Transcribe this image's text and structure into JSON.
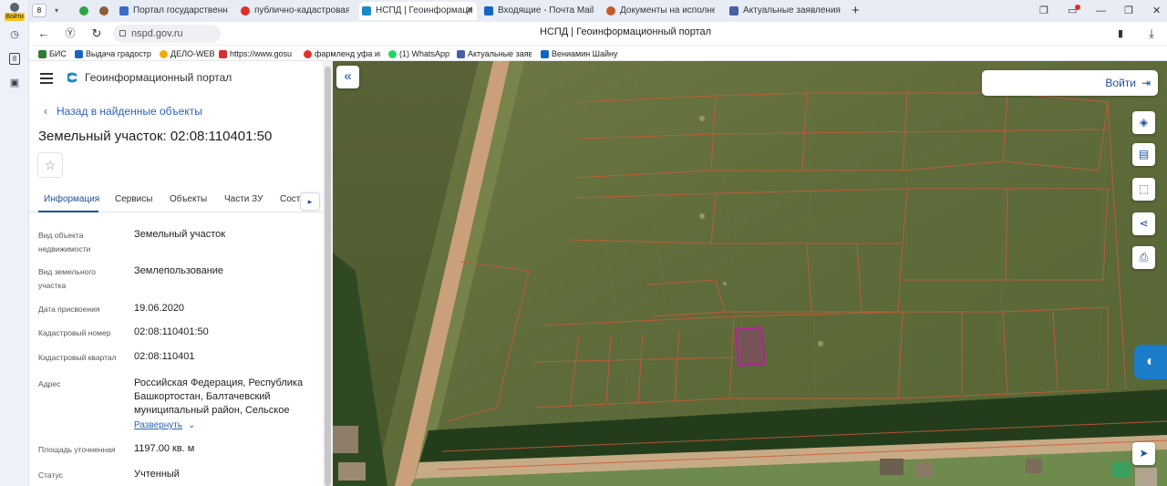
{
  "browser": {
    "profile_label": "Войти",
    "tab_count": "8",
    "tabs": [
      {
        "label": "Портал государственных",
        "color": "#3b6bc7"
      },
      {
        "label": "публично-кадастровая ка",
        "color": "#e0302c"
      },
      {
        "label": "НСПД | Геоинформаци",
        "color": "#1a8bc7",
        "active": true
      },
      {
        "label": "Входящие - Почта Mail",
        "color": "#1565c0"
      },
      {
        "label": "Документы на исполнен",
        "color": "#c75b2a"
      },
      {
        "label": "Актуальные заявления",
        "color": "#4760a8"
      }
    ],
    "url": "nspd.gov.ru",
    "page_title": "НСПД | Геоинформационный портал",
    "bookmarks": [
      {
        "label": "БИС",
        "color": "#2e7d32"
      },
      {
        "label": "Выдача градостр",
        "color": "#1565c0"
      },
      {
        "label": "ДЕЛО-WEB",
        "color": "#f2a900"
      },
      {
        "label": "https://www.gosu",
        "color": "#d32f2f"
      },
      {
        "label": "фармленд уфа ин",
        "color": "#e0302c"
      },
      {
        "label": "(1) WhatsApp",
        "color": "#25d366"
      },
      {
        "label": "Актуальные заяв",
        "color": "#4760a8"
      },
      {
        "label": "Вениамин Шайну",
        "color": "#1565c0"
      }
    ]
  },
  "panel": {
    "app_title": "Геоинформационный портал",
    "back_label": "Назад в найденные объекты",
    "object_title": "Земельный участок: 02:08:110401:50",
    "tabs": [
      "Информация",
      "Сервисы",
      "Объекты",
      "Части ЗУ",
      "Соста"
    ],
    "fields": [
      {
        "label": "Вид объекта недвижимости",
        "value": "Земельный участок"
      },
      {
        "label": "Вид земельного участка",
        "value": "Землепользование"
      },
      {
        "label": "Дата присвоения",
        "value": "19.06.2020"
      },
      {
        "label": "Кадастровый номер",
        "value": "02:08:110401:50"
      },
      {
        "label": "Кадастровый квартал",
        "value": "02:08:110401"
      },
      {
        "label": "Адрес",
        "value": "Российская Федерация, Республика Башкортостан, Балтачевский муниципальный район, Сельское"
      },
      {
        "label": "Площадь уточненная",
        "value": "1197.00 кв. м"
      },
      {
        "label": "Статус",
        "value": "Учтенный"
      }
    ],
    "expand_label": "Развернуть"
  },
  "map": {
    "login_label": "Войти",
    "tools": [
      "layers-icon",
      "ruler-icon",
      "select-area-icon",
      "share-icon",
      "print-icon"
    ],
    "colors": {
      "parcel_lines": "#d0583a",
      "selected_parcel": "#b2249a",
      "field": "#5f6e3d",
      "road": "#c9a07a"
    }
  }
}
